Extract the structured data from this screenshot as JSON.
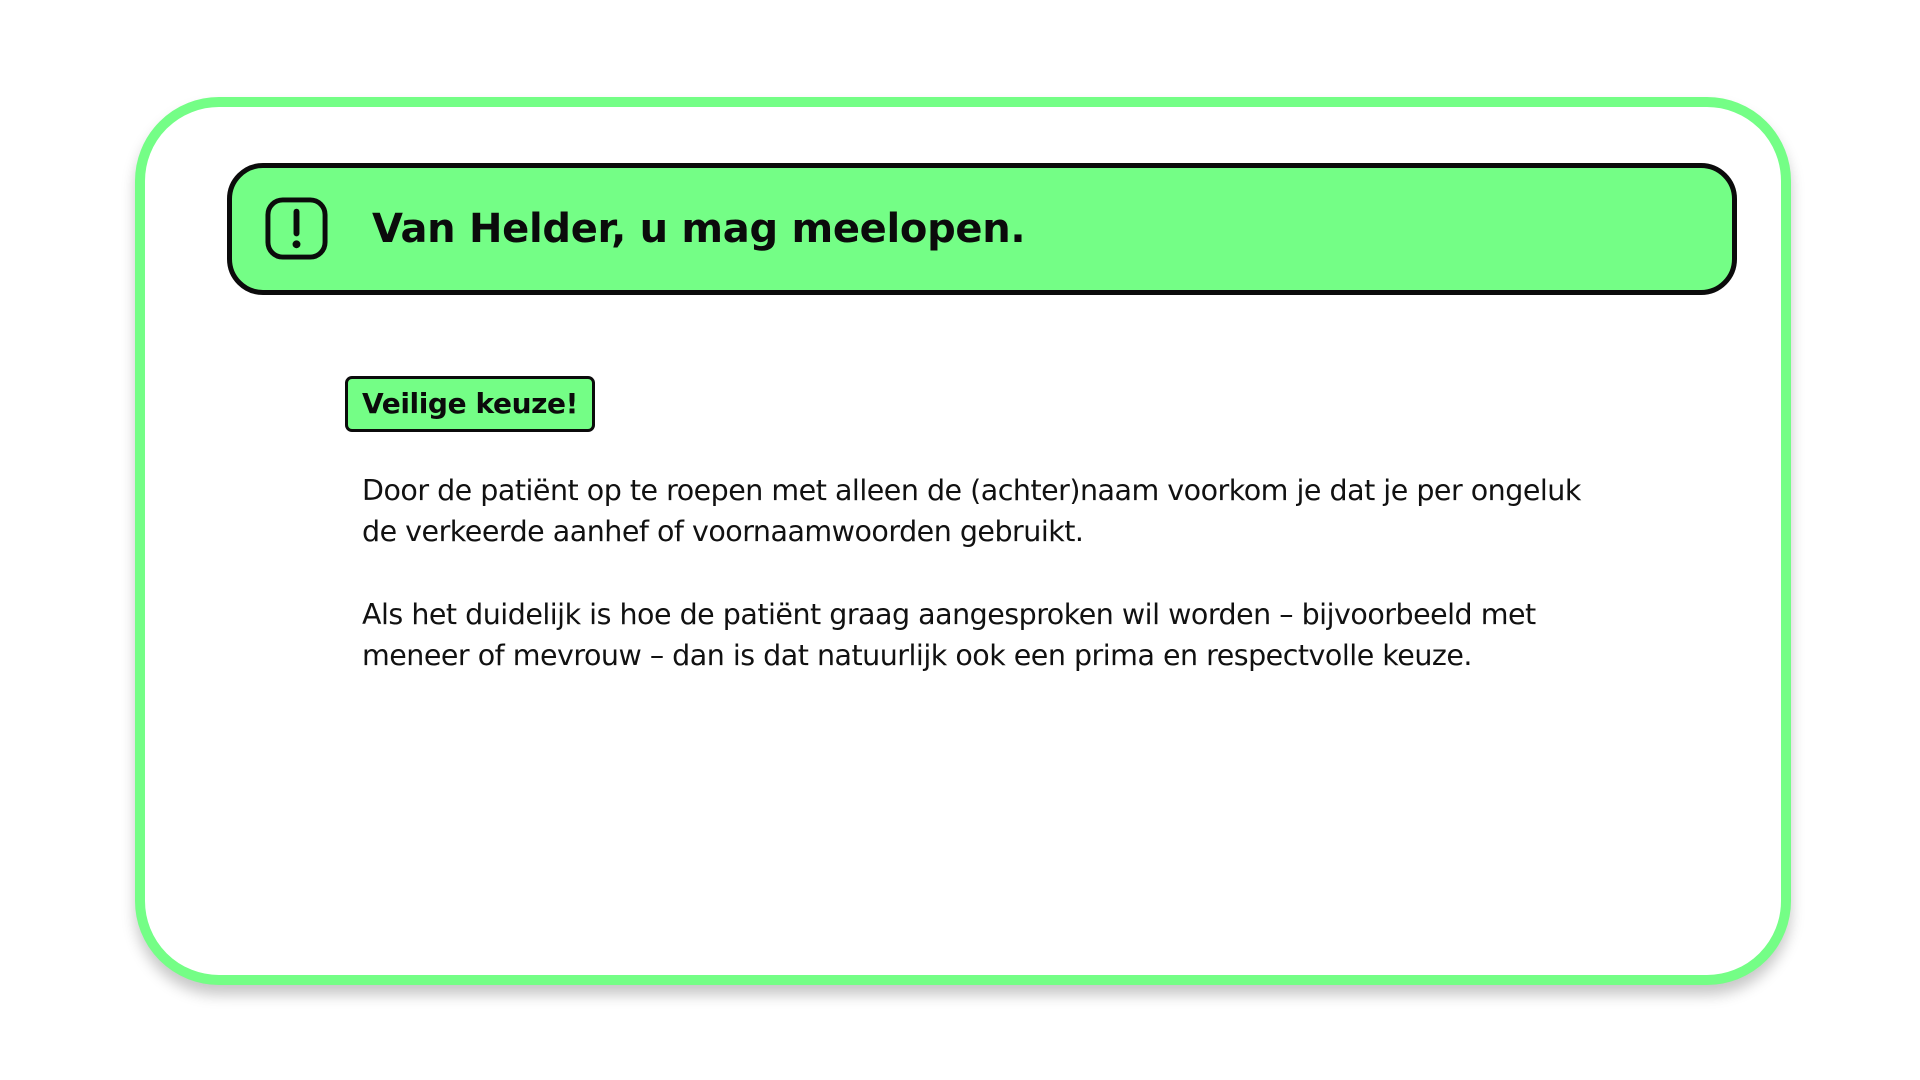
{
  "colors": {
    "accent_green": "#74fe86",
    "outline": "#0b0b0b",
    "background": "#ffffff"
  },
  "banner": {
    "icon": "alert-exclamation-icon",
    "title": "Van Helder, u mag meelopen."
  },
  "badge": {
    "label": "Veilige keuze!"
  },
  "body": {
    "paragraphs": [
      "Door de patiënt op te roepen met alleen de (achter)naam voorkom je dat je per ongeluk de verkeerde aanhef of voornaamwoorden gebruikt.",
      "Als het duidelijk is hoe de patiënt graag aangesproken wil worden – bijvoorbeeld met meneer of mevrouw – dan is dat natuurlijk ook een prima en respectvolle keuze."
    ]
  }
}
